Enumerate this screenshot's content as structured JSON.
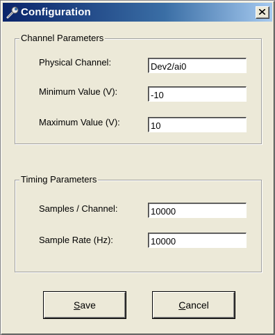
{
  "window": {
    "title": "Configuration",
    "icon": "wrench-icon",
    "close_label": "×"
  },
  "channel": {
    "group_title": "Channel Parameters",
    "physical_channel_label": "Physical Channel:",
    "physical_channel_value": "Dev2/ai0",
    "minimum_value_label": "Minimum Value (V):",
    "minimum_value_value": "-10",
    "maximum_value_label": "Maximum Value (V):",
    "maximum_value_value": "10"
  },
  "timing": {
    "group_title": "Timing Parameters",
    "samples_per_channel_label": "Samples / Channel:",
    "samples_per_channel_value": "10000",
    "sample_rate_label": "Sample Rate (Hz):",
    "sample_rate_value": "10000"
  },
  "buttons": {
    "save_mnemonic": "S",
    "save_rest": "ave",
    "cancel_mnemonic": "C",
    "cancel_rest": "ancel"
  }
}
